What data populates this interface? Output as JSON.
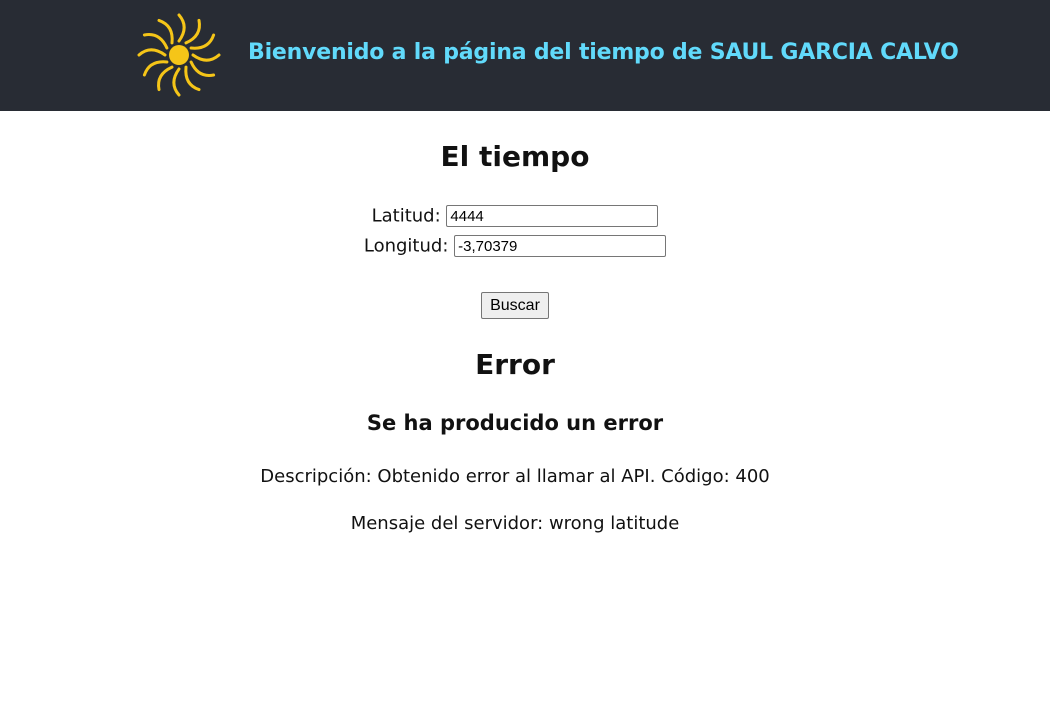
{
  "header": {
    "title": "Bienvenido a la página del tiempo de SAUL GARCIA CALVO",
    "logo_icon": "sun-icon",
    "background_color": "#282c34",
    "title_color": "#61dafb",
    "logo_color": "#f5c518"
  },
  "main": {
    "title": "El tiempo",
    "latitude": {
      "label": "Latitud:",
      "value": "4444"
    },
    "longitude": {
      "label": "Longitud:",
      "value": "-3,70379"
    },
    "search_button": "Buscar"
  },
  "error": {
    "title": "Error",
    "subtitle": "Se ha producido un error",
    "description": "Descripción: Obtenido error al llamar al API. Código: 400",
    "server_message": "Mensaje del servidor: wrong latitude"
  }
}
